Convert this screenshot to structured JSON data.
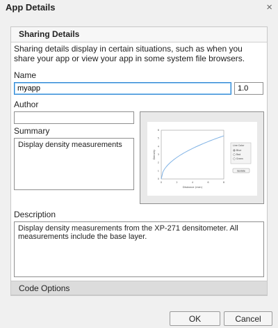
{
  "dialog": {
    "title": "App Details",
    "close_glyph": "×"
  },
  "sharing": {
    "header": "Sharing Details",
    "description": "Sharing details display in certain situations, such as when you share your app or view your app in some system file browsers."
  },
  "name": {
    "label": "Name",
    "value": "myapp",
    "version": "1.0"
  },
  "author": {
    "label": "Author",
    "value": ""
  },
  "summary": {
    "label": "Summary",
    "value": "Display density measurements"
  },
  "description": {
    "label": "Description",
    "value": "Display density measurements from the XP-271 densitometer. All measurements include the base layer."
  },
  "code_options": {
    "label": "Code Options"
  },
  "buttons": {
    "ok": "OK",
    "cancel": "Cancel"
  },
  "preview": {
    "xlabel": "Distance (mm)",
    "ylabel": "Density",
    "x_ticks": [
      "0",
      "2",
      "4",
      "6",
      "8"
    ],
    "y_ticks": [
      "0",
      "1",
      "2",
      "3",
      "4",
      "5",
      "6"
    ],
    "panel_title": "Line Color",
    "options": [
      "Blue",
      "Red",
      "Green"
    ],
    "selected": "Blue",
    "button": "Update",
    "line_color": "#7fb2e5"
  }
}
